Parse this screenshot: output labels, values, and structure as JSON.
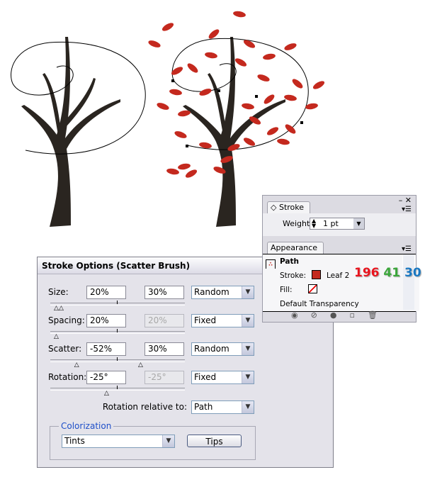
{
  "dialog": {
    "title": "Stroke Options (Scatter Brush)",
    "rows": [
      {
        "label": "Size:",
        "min": "20%",
        "max": "30%",
        "max_disabled": false,
        "mode": "Random"
      },
      {
        "label": "Spacing:",
        "min": "20%",
        "max": "20%",
        "max_disabled": true,
        "mode": "Fixed"
      },
      {
        "label": "Scatter:",
        "min": "-52%",
        "max": "30%",
        "max_disabled": false,
        "mode": "Random"
      },
      {
        "label": "Rotation:",
        "min": "-25°",
        "max": "-25°",
        "max_disabled": true,
        "mode": "Fixed"
      }
    ],
    "rotation_relative_label": "Rotation relative to:",
    "rotation_relative_value": "Path",
    "colorization_label": "Colorization",
    "colorization_method": "Tints",
    "tips_label": "Tips"
  },
  "stroke_panel": {
    "tab": "Stroke",
    "weight_label": "Weight:",
    "weight_value": "1 pt"
  },
  "appearance_panel": {
    "tab": "Appearance",
    "item": "Path",
    "stroke_label": "Stroke:",
    "stroke_name": "Leaf 2",
    "stroke_color": "#c4291e",
    "fill_label": "Fill:",
    "fill": "none",
    "transparency": "Default Transparency"
  },
  "rgb_annotation": {
    "r": "196",
    "g": "41",
    "b": "30",
    "r_color": "#e8141e",
    "g_color": "#3aa53a",
    "b_color": "#1a78c2"
  }
}
